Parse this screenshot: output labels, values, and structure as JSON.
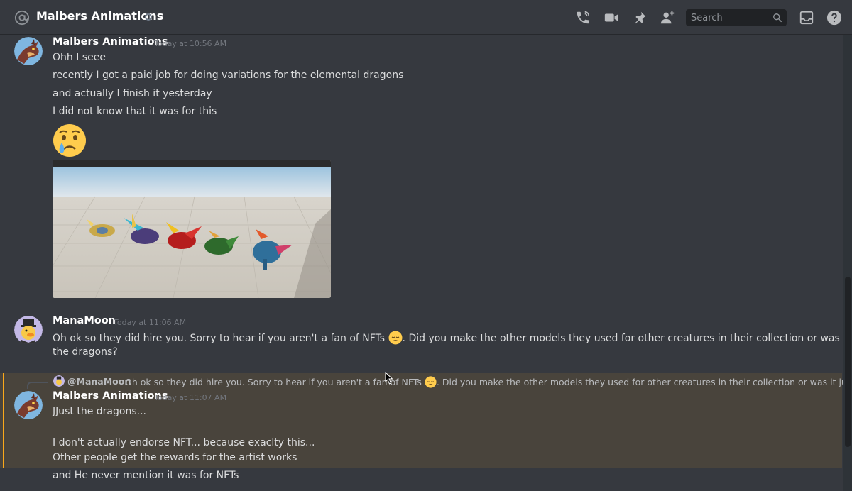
{
  "header": {
    "channel_name": "Malbers Animations",
    "search_placeholder": "Search",
    "icons": [
      "at-icon",
      "phone-call-icon",
      "video-icon",
      "pin-icon",
      "add-member-icon",
      "search-icon",
      "inbox-icon",
      "help-icon"
    ]
  },
  "messages": [
    {
      "username": "Malbers Animations",
      "timestamp": "Today at 10:56 AM",
      "lines": [
        "Ohh I seee",
        "recently I got a paid job for doing variations for the elemental dragons",
        "and actually I finish it yesterday",
        "I did not know that it was for this"
      ],
      "emoji": "crying-face",
      "attachment": "dragon-models-screenshot"
    },
    {
      "username": "ManaMoon",
      "timestamp": "Today at 11:06 AM",
      "line1_a": "Oh ok so they did hire you. Sorry to hear if you aren't a fan of NFTs",
      "line1_b": ". Did you make the other models they used for other creatures in their collection or was it just",
      "line2": "the dragons?"
    },
    {
      "reply_to_user": "@ManaMoon",
      "reply_preview_a": "Oh ok so they did hire you. Sorry to hear if you aren't a fan of NFTs",
      "reply_preview_b": ". Did you make the other models they used for other creatures in their collection or was it just the ...",
      "username": "Malbers Animations",
      "timestamp": "Today at 11:07 AM",
      "lines": [
        "JJust the dragons...",
        "I don't actually endorse NFT... because exaclty this...",
        "Other people get the rewards for the artist works",
        "and He never mention it was for NFTs"
      ]
    }
  ],
  "colors": {
    "background": "#36393f",
    "highlight": "#49443c",
    "highlight_bar": "#faa81a",
    "username": "#ffffff",
    "timestamp": "#72767d",
    "text": "#dcddde"
  }
}
